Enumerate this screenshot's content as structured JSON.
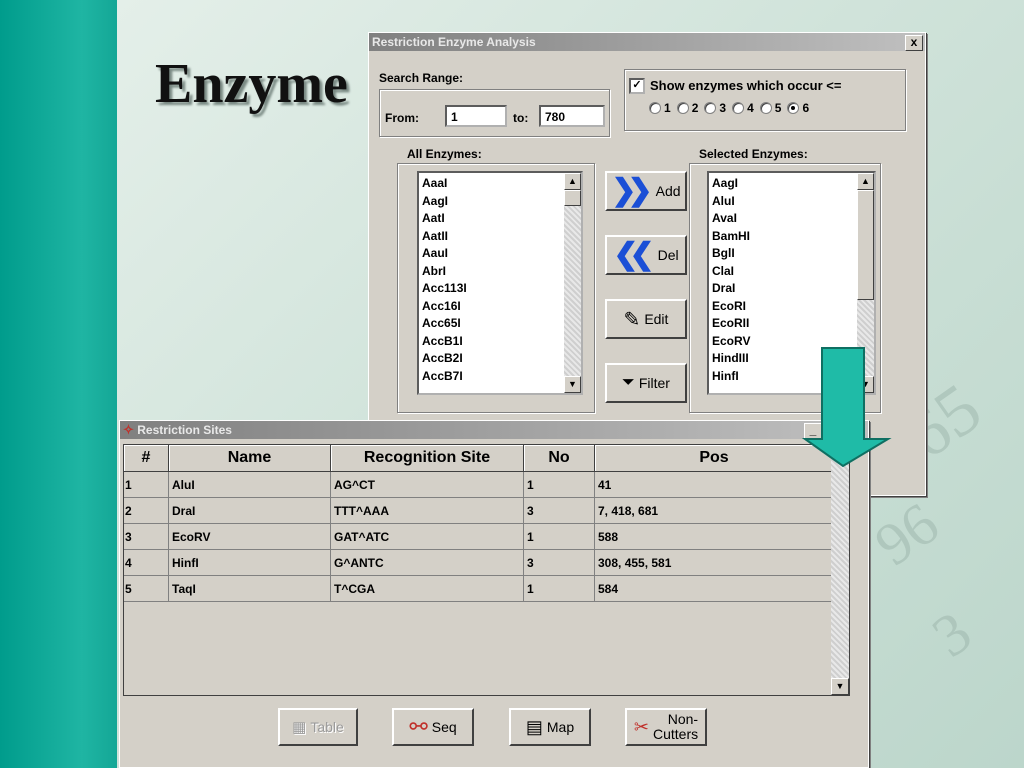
{
  "slide": {
    "title": "Enzyme",
    "accent": "#1fb5a3"
  },
  "analysis": {
    "title": "Restriction Enzyme Analysis",
    "close": "x",
    "search_range_label": "Search Range:",
    "from_label": "From:",
    "from_value": "1",
    "to_label": "to:",
    "to_value": "780",
    "show_label": "Show enzymes which occur <=",
    "show_checked": true,
    "radio_options": [
      "1",
      "2",
      "3",
      "4",
      "5",
      "6"
    ],
    "radio_selected": "6",
    "all_label": "All Enzymes:",
    "selected_label": "Selected Enzymes:",
    "all_enzymes": [
      "AaaI",
      "AagI",
      "AatI",
      "AatII",
      "AauI",
      "AbrI",
      "Acc113I",
      "Acc16I",
      "Acc65I",
      "AccB1I",
      "AccB2I",
      "AccB7I"
    ],
    "selected_enzymes": [
      "AagI",
      "AluI",
      "AvaI",
      "BamHI",
      "BglI",
      "ClaI",
      "DraI",
      "EcoRI",
      "EcoRII",
      "EcoRV",
      "HindIII",
      "HinfI"
    ],
    "buttons": {
      "add": "Add",
      "del": "Del",
      "edit": "Edit",
      "filter": "Filter"
    }
  },
  "sites": {
    "title": "Restriction Sites",
    "columns": [
      "#",
      "Name",
      "Recognition Site",
      "No",
      "Pos"
    ],
    "rows": [
      [
        "1",
        "AluI",
        "AG^CT",
        "1",
        "41"
      ],
      [
        "2",
        "DraI",
        "TTT^AAA",
        "3",
        "7, 418, 681"
      ],
      [
        "3",
        "EcoRV",
        "GAT^ATC",
        "1",
        "588"
      ],
      [
        "4",
        "HinfI",
        "G^ANTC",
        "3",
        "308, 455, 581"
      ],
      [
        "5",
        "TaqI",
        "T^CGA",
        "1",
        "584"
      ]
    ],
    "buttons": {
      "table": "Table",
      "seq": "Seq",
      "map": "Map",
      "noncutters_1": "Non-",
      "noncutters_2": "Cutters"
    }
  }
}
